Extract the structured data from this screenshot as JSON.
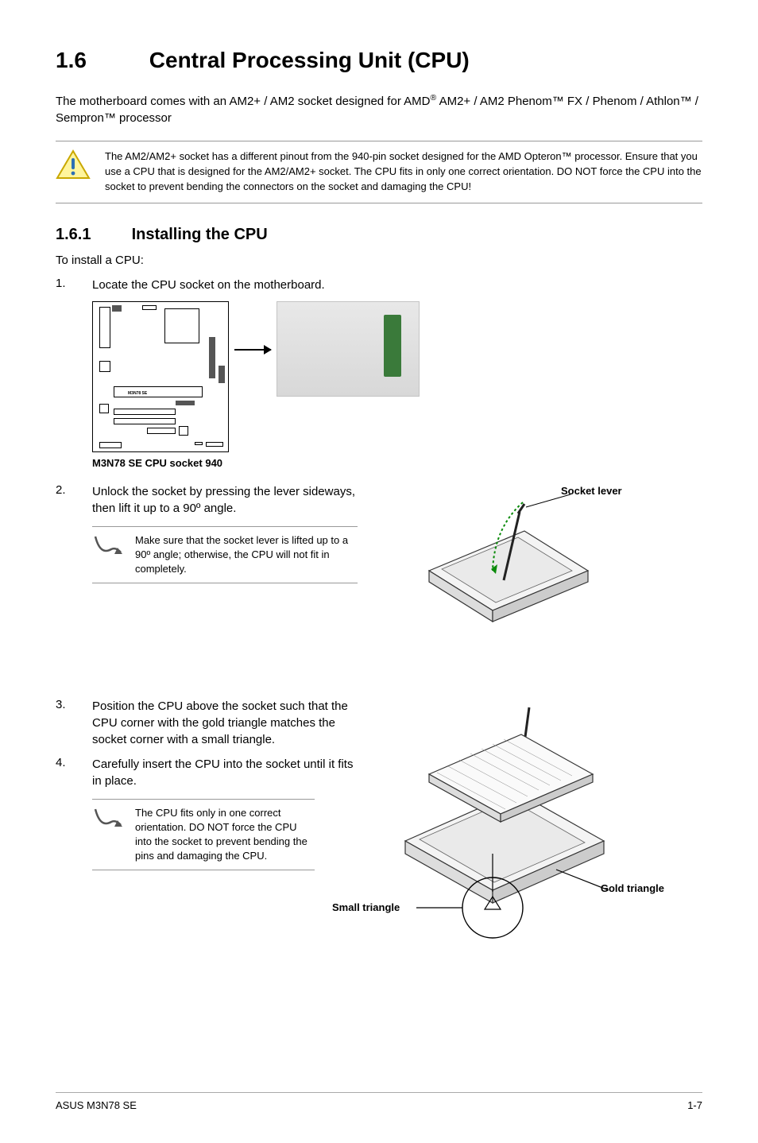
{
  "heading": {
    "number": "1.6",
    "title": "Central Processing Unit (CPU)"
  },
  "intro_line1": "The motherboard comes with an AM2+ / AM2 socket designed for AMD",
  "intro_reg": "®",
  "intro_line2": " AM2+ / AM2 Phenom™ FX / Phenom / Athlon™ / Sempron™ processor",
  "caution_text": "The AM2/AM2+ socket has a different pinout from the 940-pin socket designed for the AMD Opteron™ processor. Ensure that you use a CPU that is designed for the AM2/AM2+ socket. The CPU fits in only one correct orientation. DO NOT force the CPU into the socket to prevent bending the connectors on the socket and damaging the CPU!",
  "subheading": {
    "number": "1.6.1",
    "title": "Installing the CPU"
  },
  "to_install": "To install a CPU:",
  "step1": {
    "num": "1.",
    "text": "Locate the CPU socket on the motherboard."
  },
  "mb_caption": "M3N78 SE CPU socket 940",
  "mb_label": "M3N78 SE",
  "step2": {
    "num": "2.",
    "text": "Unlock the socket by pressing the lever sideways, then lift it up to a 90º angle."
  },
  "note2": "Make sure that the socket lever is lifted up to a 90º angle; otherwise, the CPU will not fit in completely.",
  "step3": {
    "num": "3.",
    "text": "Position the CPU above the socket such that the CPU corner with the gold triangle matches the socket corner with a small triangle."
  },
  "step4": {
    "num": "4.",
    "text": "Carefully insert the CPU into the socket until it fits in place."
  },
  "note4": "The CPU fits only in one correct orientation. DO NOT force the CPU into the socket to prevent bending the pins and damaging the CPU.",
  "labels": {
    "socket_lever": "Socket lever",
    "gold_triangle": "Gold triangle",
    "small_triangle": "Small triangle"
  },
  "footer": {
    "left": "ASUS M3N78 SE",
    "right": "1-7"
  }
}
